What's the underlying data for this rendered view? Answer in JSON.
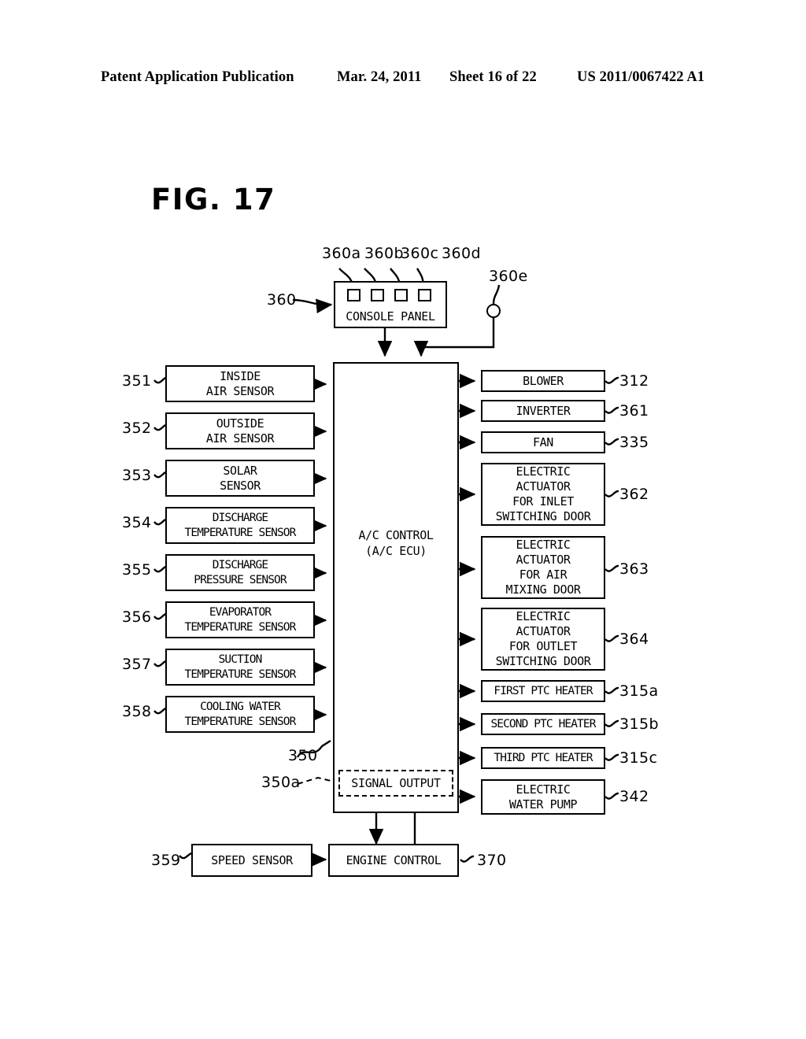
{
  "header": {
    "publication": "Patent Application Publication",
    "date": "Mar. 24, 2011",
    "sheet": "Sheet 16 of 22",
    "number": "US 2011/0067422 A1"
  },
  "figure": {
    "title": "FIG. 17"
  },
  "console": {
    "label": "CONSOLE PANEL",
    "ref": "360",
    "buttons": [
      {
        "ref": "360a"
      },
      {
        "ref": "360b"
      },
      {
        "ref": "360c"
      },
      {
        "ref": "360d"
      }
    ],
    "knob": {
      "ref": "360e"
    }
  },
  "controller": {
    "label": "A/C CONTROL\n(A/C ECU)",
    "ref": "350",
    "signal_output": {
      "label": "SIGNAL OUTPUT",
      "ref": "350a"
    }
  },
  "inputs": [
    {
      "ref": "351",
      "label": "INSIDE\nAIR SENSOR"
    },
    {
      "ref": "352",
      "label": "OUTSIDE\nAIR SENSOR"
    },
    {
      "ref": "353",
      "label": "SOLAR\nSENSOR"
    },
    {
      "ref": "354",
      "label": "DISCHARGE\nTEMPERATURE SENSOR"
    },
    {
      "ref": "355",
      "label": "DISCHARGE\nPRESSURE SENSOR"
    },
    {
      "ref": "356",
      "label": "EVAPORATOR\nTEMPERATURE SENSOR"
    },
    {
      "ref": "357",
      "label": "SUCTION\nTEMPERATURE SENSOR"
    },
    {
      "ref": "358",
      "label": "COOLING WATER\nTEMPERATURE SENSOR"
    }
  ],
  "outputs": [
    {
      "ref": "312",
      "label": "BLOWER"
    },
    {
      "ref": "361",
      "label": "INVERTER"
    },
    {
      "ref": "335",
      "label": "FAN"
    },
    {
      "ref": "362",
      "label": "ELECTRIC\nACTUATOR\nFOR INLET\nSWITCHING DOOR"
    },
    {
      "ref": "363",
      "label": "ELECTRIC\nACTUATOR\nFOR AIR\nMIXING DOOR"
    },
    {
      "ref": "364",
      "label": "ELECTRIC\nACTUATOR\nFOR OUTLET\nSWITCHING DOOR"
    },
    {
      "ref": "315a",
      "label": "FIRST PTC HEATER"
    },
    {
      "ref": "315b",
      "label": "SECOND PTC HEATER"
    },
    {
      "ref": "315c",
      "label": "THIRD PTC HEATER"
    },
    {
      "ref": "342",
      "label": "ELECTRIC\nWATER PUMP"
    }
  ],
  "bottom": {
    "speed_sensor": {
      "ref": "359",
      "label": "SPEED SENSOR"
    },
    "engine_control": {
      "ref": "370",
      "label": "ENGINE CONTROL"
    }
  },
  "colors": {
    "ink": "#000000",
    "paper": "#ffffff"
  }
}
